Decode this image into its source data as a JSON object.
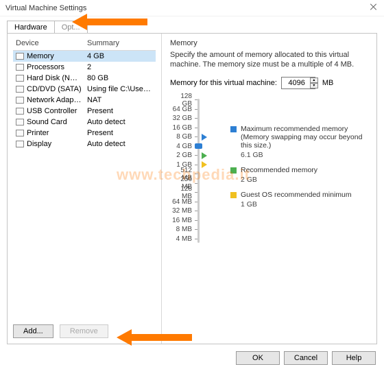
{
  "window": {
    "title": "Virtual Machine Settings"
  },
  "tabs": {
    "hardware": "Hardware",
    "options": "Opt..."
  },
  "device_headers": {
    "device": "Device",
    "summary": "Summary"
  },
  "devices": [
    {
      "name": "Memory",
      "summary": "4 GB",
      "selected": true
    },
    {
      "name": "Processors",
      "summary": "2"
    },
    {
      "name": "Hard Disk (NVMe)",
      "summary": "80 GB"
    },
    {
      "name": "CD/DVD (SATA)",
      "summary": "Using file C:\\Users\\Techpedi..."
    },
    {
      "name": "Network Adapter",
      "summary": "NAT"
    },
    {
      "name": "USB Controller",
      "summary": "Present"
    },
    {
      "name": "Sound Card",
      "summary": "Auto detect"
    },
    {
      "name": "Printer",
      "summary": "Present"
    },
    {
      "name": "Display",
      "summary": "Auto detect"
    }
  ],
  "buttons": {
    "add": "Add...",
    "remove": "Remove",
    "ok": "OK",
    "cancel": "Cancel",
    "help": "Help"
  },
  "memory": {
    "group": "Memory",
    "desc": "Specify the amount of memory allocated to this virtual machine. The memory size must be a multiple of 4 MB.",
    "label": "Memory for this virtual machine:",
    "value": "4096",
    "unit": "MB"
  },
  "ticks": [
    "128 GB",
    "64 GB",
    "32 GB",
    "16 GB",
    "8 GB",
    "4 GB",
    "2 GB",
    "1 GB",
    "512 MB",
    "256 MB",
    "128 MB",
    "64 MB",
    "32 MB",
    "16 MB",
    "8 MB",
    "4 MB"
  ],
  "legend": {
    "max": "Maximum recommended memory",
    "max_note": "(Memory swapping may occur beyond this size.)",
    "max_val": "6.1 GB",
    "rec": "Recommended memory",
    "rec_val": "2 GB",
    "min": "Guest OS recommended minimum",
    "min_val": "1 GB"
  },
  "watermark": "www.techpedia.it"
}
